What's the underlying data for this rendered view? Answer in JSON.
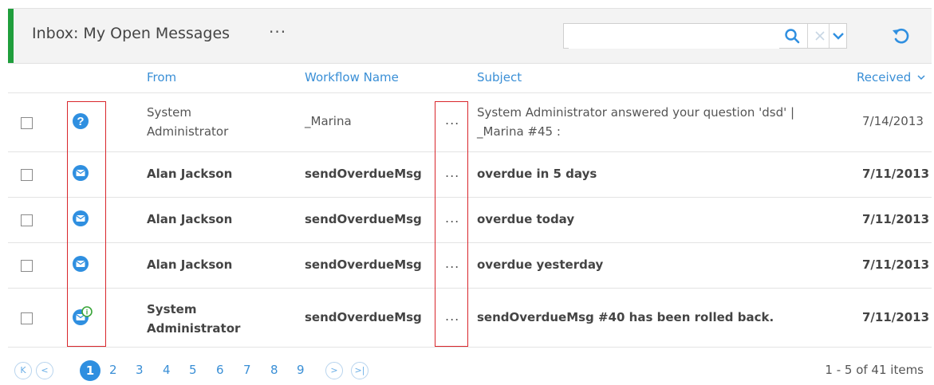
{
  "header": {
    "title": "Inbox: My Open Messages",
    "more": "···",
    "search": {
      "value": "",
      "placeholder": ""
    },
    "icons": {
      "search": "search-icon",
      "clear": "clear-icon",
      "dropdown": "chevron-down-icon",
      "refresh": "refresh-icon"
    }
  },
  "columns": {
    "from": "From",
    "workflow": "Workflow Name",
    "subject": "Subject",
    "received": "Received"
  },
  "rows": [
    {
      "icon": "question-icon",
      "from_line1": "System",
      "from_line2": "Administrator",
      "workflow": "_Marina",
      "more": "...",
      "subject_line1": "System Administrator answered your question 'dsd' |",
      "subject_line2": "_Marina #45 :",
      "received": "7/14/2013",
      "unread": false
    },
    {
      "icon": "mail-icon",
      "from": "Alan Jackson",
      "workflow": "sendOverdueMsg",
      "more": "...",
      "subject": "overdue in 5 days",
      "received": "7/11/2013",
      "unread": true
    },
    {
      "icon": "mail-icon",
      "from": "Alan Jackson",
      "workflow": "sendOverdueMsg",
      "more": "...",
      "subject": "overdue today",
      "received": "7/11/2013",
      "unread": true
    },
    {
      "icon": "mail-icon",
      "from": "Alan Jackson",
      "workflow": "sendOverdueMsg",
      "more": "...",
      "subject": "overdue yesterday",
      "received": "7/11/2013",
      "unread": true
    },
    {
      "icon": "mail-info-icon",
      "from_line1": "System",
      "from_line2": "Administrator",
      "workflow": "sendOverdueMsg",
      "more": "...",
      "subject": "sendOverdueMsg #40 has been rolled back.",
      "received": "7/11/2013",
      "unread": true
    }
  ],
  "pager": {
    "first": "K",
    "prev": "<",
    "next": ">",
    "last": ">|",
    "current": "1",
    "pages": [
      "2",
      "3",
      "4",
      "5",
      "6",
      "7",
      "8",
      "9"
    ],
    "info": "1 - 5 of 41 items"
  },
  "colors": {
    "accent": "#1f9e3c",
    "link": "#3a8fd6",
    "icon": "#2f8fe0",
    "highlight": "#d9262b",
    "info_badge": "#3aa53a"
  }
}
